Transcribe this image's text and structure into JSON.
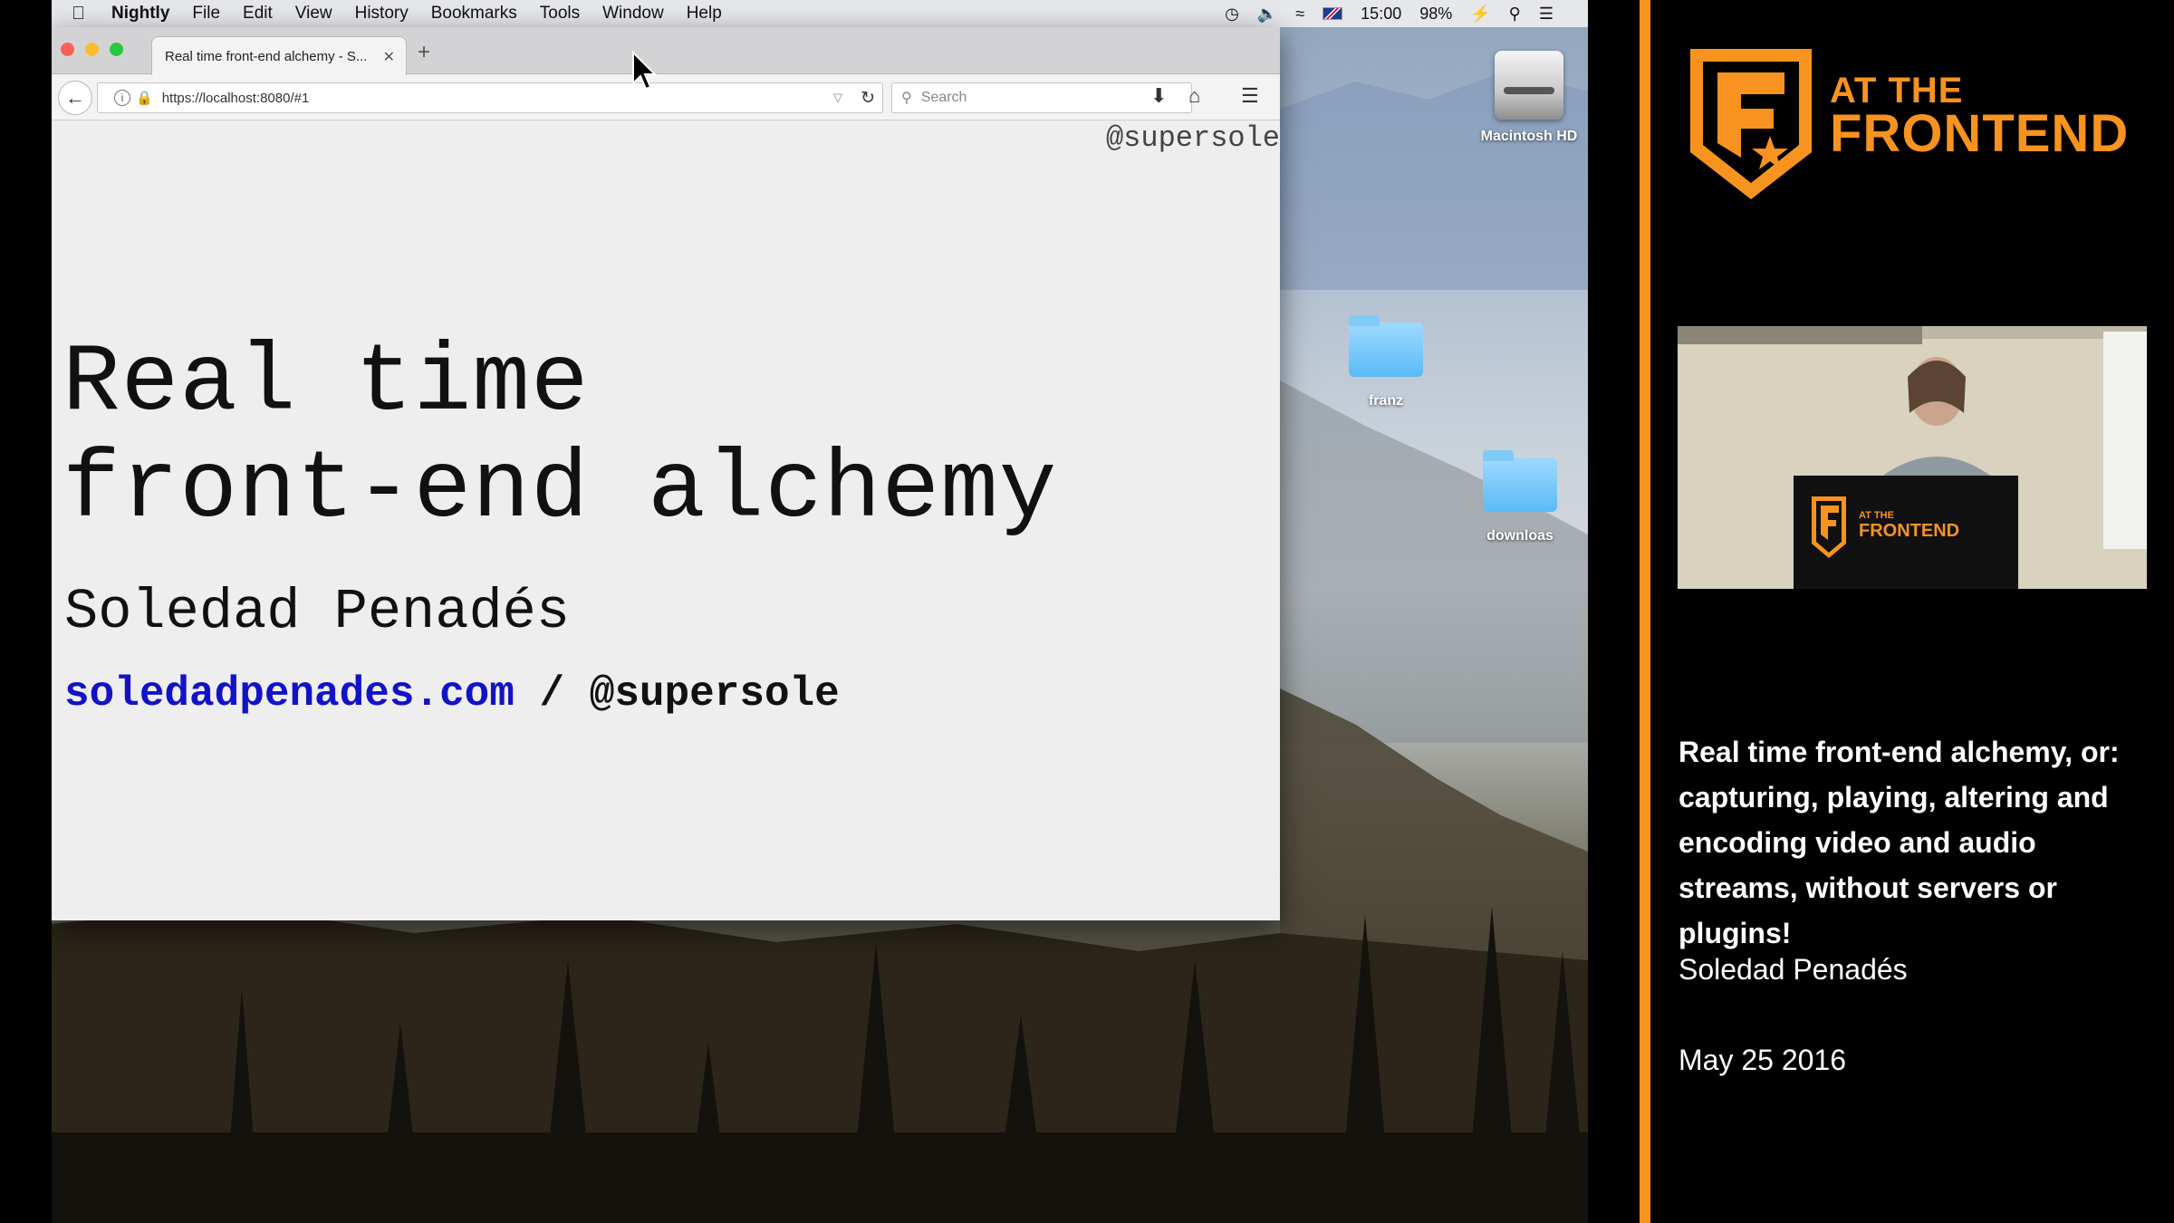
{
  "menubar": {
    "app": "Nightly",
    "items": [
      "File",
      "Edit",
      "View",
      "History",
      "Bookmarks",
      "Tools",
      "Window",
      "Help"
    ],
    "time": "15:00",
    "battery": "98%"
  },
  "browser": {
    "tab_title": "Real time front-end alchemy - S...",
    "url": "https://localhost:8080/#1",
    "search_placeholder": "Search"
  },
  "slide": {
    "handle_top": "@supersole",
    "title_line1": "Real time",
    "title_line2": "front-end alchemy",
    "author": "Soledad Penadés",
    "link": "soledadpenades.com",
    "separator": " / ",
    "handle": "@supersole"
  },
  "desktop": {
    "icons": [
      {
        "label": "Macintosh HD",
        "type": "drive"
      },
      {
        "label": "franz",
        "type": "folder"
      },
      {
        "label": "downloas",
        "type": "folder"
      }
    ]
  },
  "sidebar": {
    "logo_line1": "AT THE",
    "logo_line2": "FRONTEND",
    "talk_title": "Real time front-end alchemy, or: capturing, playing, altering and encoding video and audio streams, without servers or plugins!",
    "speaker": "Soledad Penadés",
    "date": "May 25 2016",
    "camera_logo_line1": "AT THE",
    "camera_logo_line2": "FRONTEND"
  },
  "colors": {
    "brand_orange": "#f7931e",
    "link_blue": "#1212c8"
  }
}
